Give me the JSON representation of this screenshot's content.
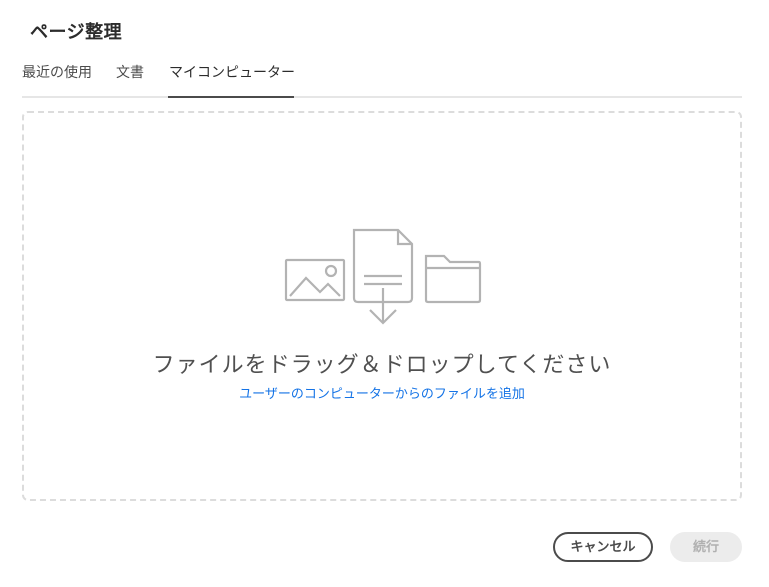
{
  "dialog": {
    "title": "ページ整理"
  },
  "tabs": [
    {
      "label": "最近の使用"
    },
    {
      "label": "文書"
    },
    {
      "label": "マイコンピューター",
      "active": true
    }
  ],
  "dropzone": {
    "message": "ファイルをドラッグ＆ドロップしてください",
    "link_label": "ユーザーのコンピューターからのファイルを追加",
    "icons": [
      "image-icon",
      "document-download-icon",
      "folder-icon"
    ]
  },
  "footer": {
    "cancel_label": "キャンセル",
    "continue_label": "続行",
    "continue_enabled": false
  },
  "colors": {
    "link": "#1473e6",
    "icon_stroke": "#b3b3b3",
    "active_tab_underline": "#4b4b4b"
  }
}
